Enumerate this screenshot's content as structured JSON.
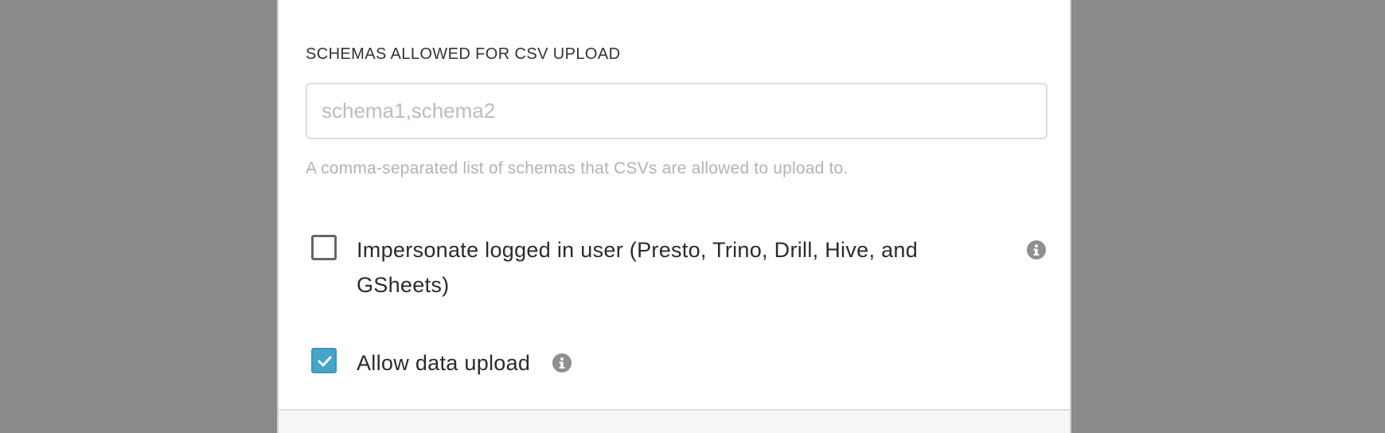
{
  "schemas_field": {
    "label": "SCHEMAS ALLOWED FOR CSV UPLOAD",
    "value": "",
    "placeholder": "schema1,schema2",
    "helper": "A comma-separated list of schemas that CSVs are allowed to upload to."
  },
  "options": {
    "impersonate": {
      "label": "Impersonate logged in user (Presto, Trino, Drill, Hive, and GSheets)",
      "checked": false,
      "icon": "info-icon"
    },
    "allow_upload": {
      "label": "Allow data upload",
      "checked": true,
      "icon": "info-icon"
    }
  },
  "colors": {
    "backdrop": "#8a8a8a",
    "checkbox_checked": "#46a4c8",
    "info_icon": "#8f8f8f",
    "helper_text": "#b3b3b3"
  }
}
